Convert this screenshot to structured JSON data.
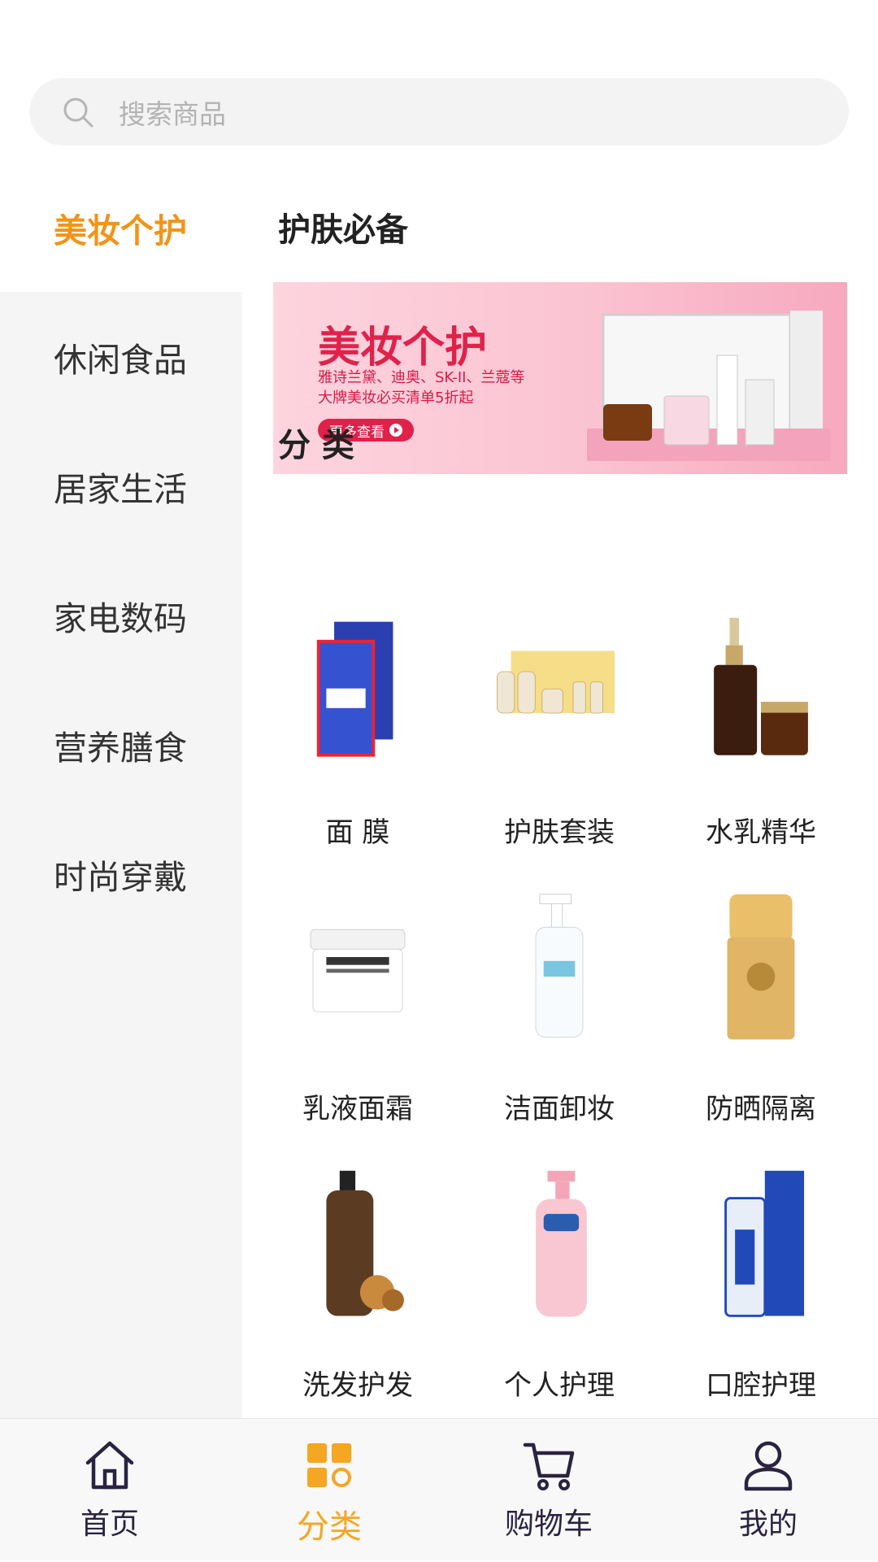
{
  "search": {
    "placeholder": "搜索商品"
  },
  "sidebar": {
    "active_color": "#f29418",
    "items": [
      {
        "label": "美妆个护",
        "active": true
      },
      {
        "label": "休闲食品"
      },
      {
        "label": "居家生活"
      },
      {
        "label": "家电数码"
      },
      {
        "label": "营养膳食"
      },
      {
        "label": "时尚穿戴"
      }
    ]
  },
  "main": {
    "section_title": "护肤必备",
    "banner": {
      "title": "美妆个护",
      "line1": "雅诗兰黛、迪奥、SK-II、兰蔻等",
      "line2": "大牌美妆必买清单5折起",
      "button": "更多查看"
    },
    "category_title": "分 类",
    "categories": [
      {
        "label": "面 膜",
        "icon": "face-mask-icon"
      },
      {
        "label": "护肤套装",
        "icon": "skincare-set-icon"
      },
      {
        "label": "水乳精华",
        "icon": "serum-icon"
      },
      {
        "label": "乳液面霜",
        "icon": "cream-jar-icon"
      },
      {
        "label": "洁面卸妆",
        "icon": "cleanser-bottle-icon"
      },
      {
        "label": "防晒隔离",
        "icon": "sunscreen-icon"
      },
      {
        "label": "洗发护发",
        "icon": "shampoo-icon"
      },
      {
        "label": "个人护理",
        "icon": "lotion-icon"
      },
      {
        "label": "口腔护理",
        "icon": "toothpaste-icon"
      }
    ]
  },
  "bottom_nav": {
    "accent": "#f5a623",
    "items": [
      {
        "label": "首页",
        "icon": "home-icon"
      },
      {
        "label": "分类",
        "icon": "category-icon",
        "active": true
      },
      {
        "label": "购物车",
        "icon": "cart-icon"
      },
      {
        "label": "我的",
        "icon": "user-icon"
      }
    ]
  }
}
